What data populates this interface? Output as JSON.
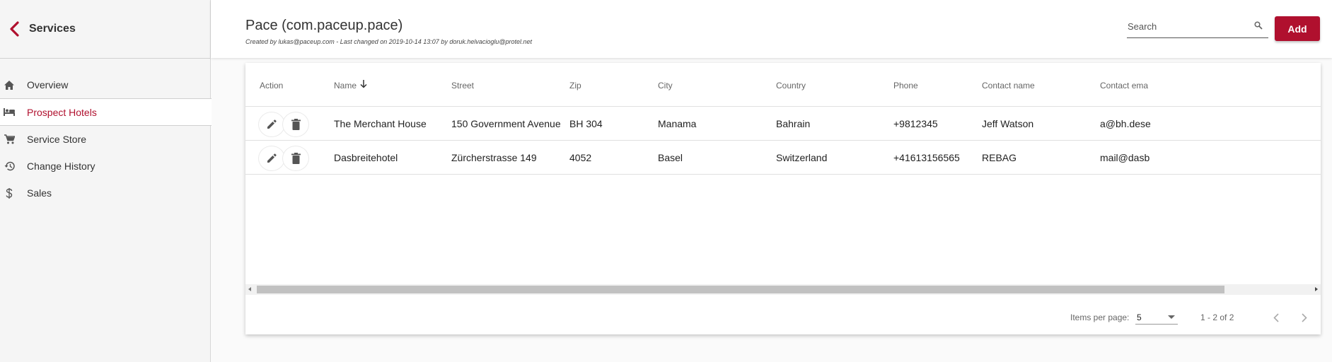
{
  "sidebar": {
    "title": "Services",
    "items": [
      {
        "label": "Overview",
        "icon": "home-icon"
      },
      {
        "label": "Prospect Hotels",
        "icon": "hotel-bed-icon",
        "active": true
      },
      {
        "label": "Service Store",
        "icon": "cart-icon"
      },
      {
        "label": "Change History",
        "icon": "history-icon"
      },
      {
        "label": "Sales",
        "icon": "dollar-icon"
      }
    ]
  },
  "header": {
    "title": "Pace (com.paceup.pace)",
    "subtitle": "Created by lukas@paceup.com - Last changed on 2019-10-14 13:07 by doruk.helvacioglu@protel.net",
    "search_placeholder": "Search",
    "add_label": "Add"
  },
  "table": {
    "columns": [
      "Action",
      "Name",
      "Street",
      "Zip",
      "City",
      "Country",
      "Phone",
      "Contact name",
      "Contact ema"
    ],
    "sorted_column": "Name",
    "sort_direction": "descending",
    "rows": [
      [
        "The Merchant House",
        "150 Government Avenue",
        "BH 304",
        "Manama",
        "Bahrain",
        "+9812345",
        "Jeff Watson",
        "a@bh.dese"
      ],
      [
        "Dasbreitehotel",
        "Zürcherstrasse 149",
        "4052",
        "Basel",
        "Switzerland",
        "+41613156565",
        "REBAG",
        "mail@dasb"
      ]
    ]
  },
  "pagination": {
    "items_per_page_label": "Items per page:",
    "items_per_page": "5",
    "range": "1 - 2 of 2"
  },
  "colors": {
    "accent": "#b0102e",
    "sidebar_bg": "#f5f5f5"
  }
}
